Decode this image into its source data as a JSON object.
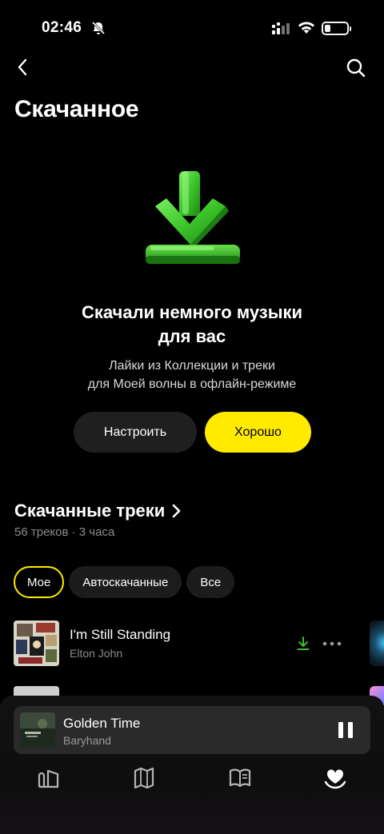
{
  "status": {
    "time": "02:46"
  },
  "page": {
    "title": "Скачанное"
  },
  "hero": {
    "title_line1": "Скачали немного музыки",
    "title_line2": "для вас",
    "subtitle_line1": "Лайки из Коллекции и треки",
    "subtitle_line2": "для Моей волны в офлайн-режиме",
    "setup_label": "Настроить",
    "ok_label": "Хорошо"
  },
  "downloads": {
    "title": "Скачанные треки",
    "summary": "56 треков · 3 часа",
    "filters": [
      "Мое",
      "Автоскачанные",
      "Все"
    ],
    "active_filter": "Мое",
    "tracks": [
      {
        "title": "I'm Still Standing",
        "artist": "Elton John"
      }
    ]
  },
  "player": {
    "title": "Golden Time",
    "artist": "Baryhand",
    "state": "playing"
  },
  "tabs": [
    "home-icon",
    "map-icon",
    "book-icon",
    "collection-heart-icon"
  ],
  "colors": {
    "accent": "#ffea00",
    "download_green": "#3dbb2e",
    "background": "#000000"
  }
}
